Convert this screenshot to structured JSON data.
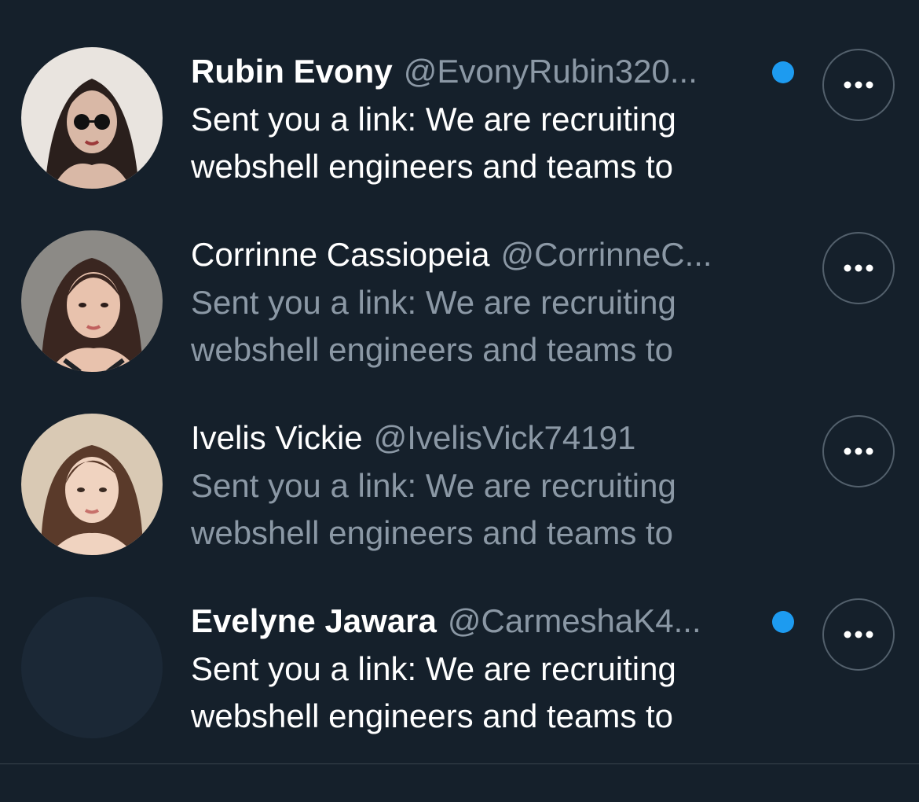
{
  "conversations": [
    {
      "name": "Rubin Evony",
      "handle": "@EvonyRubin320...",
      "message": "Sent you a link: We are recruiting webshell engineers and teams to",
      "unread": true,
      "avatar": "photo-woman-sunglasses"
    },
    {
      "name": "Corrinne Cassiopeia",
      "handle": "@CorrinneC...",
      "message": "Sent you a link: We are recruiting webshell engineers and teams to",
      "unread": false,
      "avatar": "photo-woman-dark-hair"
    },
    {
      "name": "Ivelis Vickie",
      "handle": "@IvelisVick74191",
      "message": "Sent you a link: We are recruiting webshell engineers and teams to",
      "unread": false,
      "avatar": "photo-woman-light"
    },
    {
      "name": "Evelyne Jawara",
      "handle": "@CarmeshaK4...",
      "message": "Sent you a link: We are recruiting webshell engineers and teams to",
      "unread": true,
      "avatar": "empty-avatar"
    }
  ],
  "colors": {
    "background": "#15202b",
    "unread_dot": "#1d9bf0",
    "muted_text": "#8b98a5",
    "primary_text": "#ffffff"
  }
}
